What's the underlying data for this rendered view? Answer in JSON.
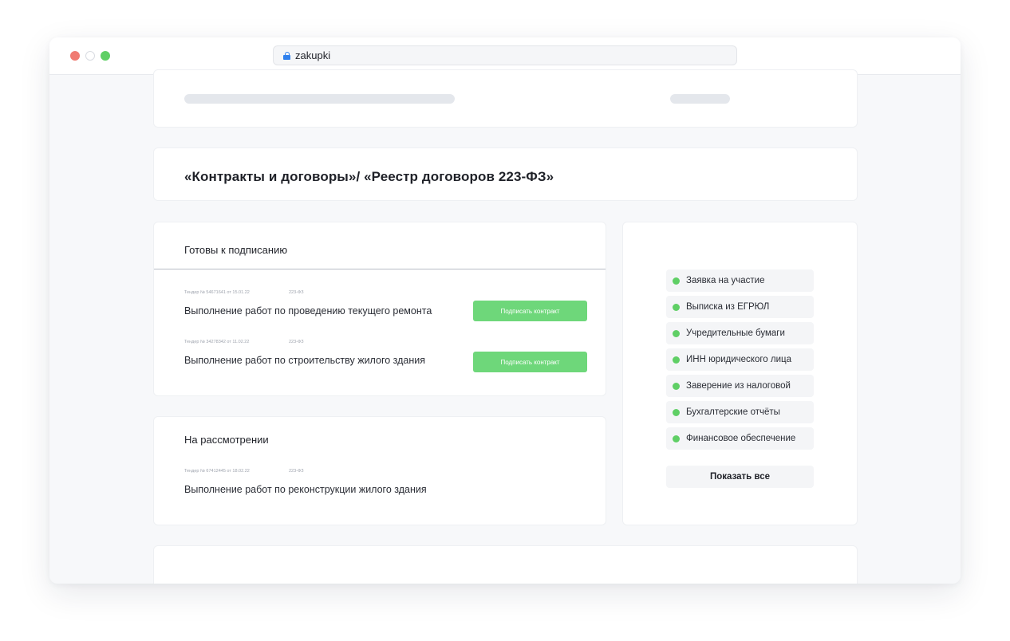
{
  "browser": {
    "url": "zakupki"
  },
  "header": {
    "title": "«Контракты и договоры»/ «Реестр договоров 223-ФЗ»"
  },
  "ready": {
    "title": "Готовы к подписанию",
    "items": [
      {
        "tender": "Тендер № 54671641 от 15.01.22",
        "law": "223-ФЗ",
        "title": "Выполнение работ по проведению текущего ремонта",
        "button": "Подписать контракт"
      },
      {
        "tender": "Тендер № 34278342 от 11.02.22",
        "law": "223-ФЗ",
        "title": "Выполнение работ по строительству жилого здания",
        "button": "Подписать контракт"
      }
    ]
  },
  "review": {
    "title": "На рассмотрении",
    "items": [
      {
        "tender": "Тендер № 67412445 от 18.02.22",
        "law": "223-ФЗ",
        "title": "Выполнение работ по реконструкции жилого здания"
      }
    ]
  },
  "documents": {
    "items": [
      {
        "label": "Заявка на участие",
        "status_color": "#5fcf65"
      },
      {
        "label": "Выписка из ЕГРЮЛ",
        "status_color": "#5fcf65"
      },
      {
        "label": "Учредительные бумаги",
        "status_color": "#5fcf65"
      },
      {
        "label": "ИНН юридического лица",
        "status_color": "#5fcf65"
      },
      {
        "label": "Заверение из налоговой",
        "status_color": "#5fcf65"
      },
      {
        "label": "Бухгалтерские отчёты",
        "status_color": "#5fcf65"
      },
      {
        "label": "Финансовое обеспечение",
        "status_color": "#5fcf65"
      }
    ],
    "show_all": "Показать все"
  },
  "colors": {
    "accent_green": "#6ed77a",
    "status_green": "#5fcf65",
    "lock_blue": "#2f80ed"
  }
}
